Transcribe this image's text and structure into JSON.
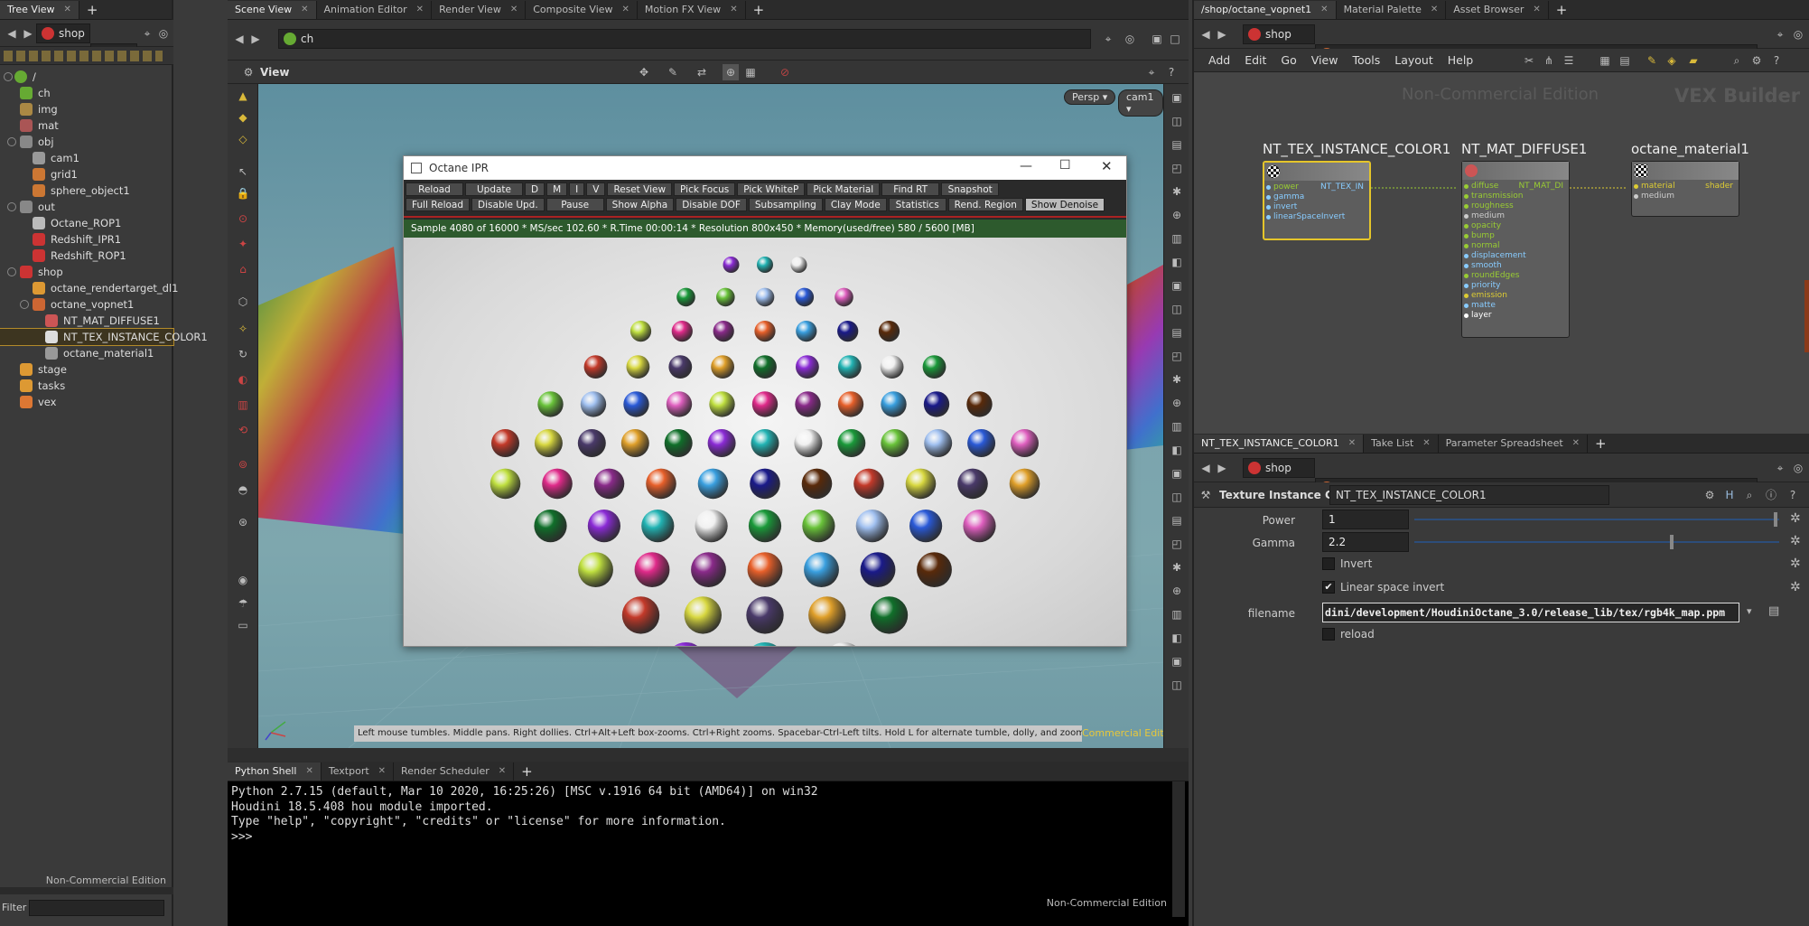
{
  "left_panel": {
    "tab_label": "Tree View",
    "path": "shop",
    "path2": "...",
    "root": "/",
    "items": [
      {
        "label": "ch",
        "indent": 1,
        "color": "#6a3"
      },
      {
        "label": "img",
        "indent": 1,
        "color": "#a84"
      },
      {
        "label": "mat",
        "indent": 1,
        "color": "#a55"
      },
      {
        "label": "obj",
        "indent": 1,
        "color": "#888"
      },
      {
        "label": "cam1",
        "indent": 2,
        "color": "#999"
      },
      {
        "label": "grid1",
        "indent": 2,
        "color": "#c73"
      },
      {
        "label": "sphere_object1",
        "indent": 2,
        "color": "#c73"
      },
      {
        "label": "out",
        "indent": 1,
        "color": "#888"
      },
      {
        "label": "Octane_ROP1",
        "indent": 2,
        "color": "#bbb"
      },
      {
        "label": "Redshift_IPR1",
        "indent": 2,
        "color": "#c33"
      },
      {
        "label": "Redshift_ROP1",
        "indent": 2,
        "color": "#c33"
      },
      {
        "label": "shop",
        "indent": 1,
        "color": "#c33"
      },
      {
        "label": "octane_rendertarget_dl1",
        "indent": 2,
        "color": "#d93"
      },
      {
        "label": "octane_vopnet1",
        "indent": 2,
        "color": "#c63"
      },
      {
        "label": "NT_MAT_DIFFUSE1",
        "indent": 3,
        "color": "#c55"
      },
      {
        "label": "NT_TEX_INSTANCE_COLOR1",
        "indent": 3,
        "color": "#ddd",
        "selected": true
      },
      {
        "label": "octane_material1",
        "indent": 3,
        "color": "#999"
      },
      {
        "label": "stage",
        "indent": 1,
        "color": "#d93"
      },
      {
        "label": "tasks",
        "indent": 1,
        "color": "#d93"
      },
      {
        "label": "vex",
        "indent": 1,
        "color": "#d73"
      }
    ],
    "watermark": "Non-Commercial Edition",
    "filter_label": "Filter"
  },
  "center": {
    "tabs": [
      "Scene View",
      "Animation Editor",
      "Render View",
      "Composite View",
      "Motion FX View"
    ],
    "path": "ch",
    "view_label": "View",
    "persp": "Persp",
    "camera": "cam1",
    "hint": "Left mouse tumbles. Middle pans. Right dollies. Ctrl+Alt+Left box-zooms. Ctrl+Right zooms. Spacebar-Ctrl-Left tilts. Hold L for alternate tumble, dolly, and zoom.",
    "watermark": "Commercial Edition"
  },
  "octane": {
    "title": "Octane IPR",
    "row1": [
      "Reload",
      "Update",
      "D",
      "M",
      "I",
      "V",
      "Reset View",
      "Pick Focus",
      "Pick WhiteP",
      "Pick Material",
      "Find RT",
      "Snapshot"
    ],
    "row2": [
      "Full Reload",
      "Disable Upd.",
      "Pause",
      "Show Alpha",
      "Disable DOF",
      "Subsampling",
      "Clay Mode",
      "Statistics",
      "Rend. Region",
      "Show Denoise"
    ],
    "status": "Sample 4080 of 16000 * MS/sec 102.60 * R.Time 00:00:14 * Resolution 800x450 * Memory(used/free) 580 / 5600 [MB]"
  },
  "console": {
    "tabs": [
      "Python Shell",
      "Textport",
      "Render Scheduler"
    ],
    "lines": [
      "Python 2.7.15 (default, Mar 10 2020, 16:25:26) [MSC v.1916 64 bit (AMD64)] on win32",
      "Houdini 18.5.408 hou module imported.",
      "Type \"help\", \"copyright\", \"credits\" or \"license\" for more information.",
      ">>>"
    ],
    "watermark": "Non-Commercial Edition"
  },
  "network": {
    "tabs": [
      "/shop/octane_vopnet1",
      "Material Palette",
      "Asset Browser"
    ],
    "path1": "shop",
    "path2": "octane_vopnet1",
    "menu": [
      "Add",
      "Edit",
      "Go",
      "View",
      "Tools",
      "Layout",
      "Help"
    ],
    "watermark": "Non-Commercial Edition",
    "context": "VEX Builder",
    "nodes": {
      "tex": {
        "title": "NT_TEX_INSTANCE_COLOR1",
        "ports": [
          "power",
          "gamma",
          "invert",
          "linearSpaceInvert"
        ],
        "out": "NT_TEX_IN"
      },
      "diffuse": {
        "title": "NT_MAT_DIFFUSE1",
        "ports": [
          "diffuse",
          "transmission",
          "roughness",
          "medium",
          "opacity",
          "bump",
          "normal",
          "displacement",
          "smooth",
          "roundEdges",
          "priority",
          "emission",
          "matte",
          "layer"
        ],
        "out": "NT_MAT_DI"
      },
      "mat": {
        "title": "octane_material1",
        "ports": [
          "material",
          "medium"
        ],
        "out": "shader"
      }
    }
  },
  "params": {
    "tabs": [
      "NT_TEX_INSTANCE_COLOR1",
      "Take List",
      "Parameter Spreadsheet"
    ],
    "path1": "shop",
    "path2": "octane_vopnet1",
    "type_label": "Texture Instance Color",
    "node_name": "NT_TEX_INSTANCE_COLOR1",
    "power_label": "Power",
    "power_value": "1",
    "gamma_label": "Gamma",
    "gamma_value": "2.2",
    "invert_label": "Invert",
    "lsi_label": "Linear space invert",
    "filename_label": "filename",
    "filename_value": "dini/development/HoudiniOctane_3.0/release_lib/tex/rgb4k_map.ppm",
    "reload_label": "reload"
  }
}
